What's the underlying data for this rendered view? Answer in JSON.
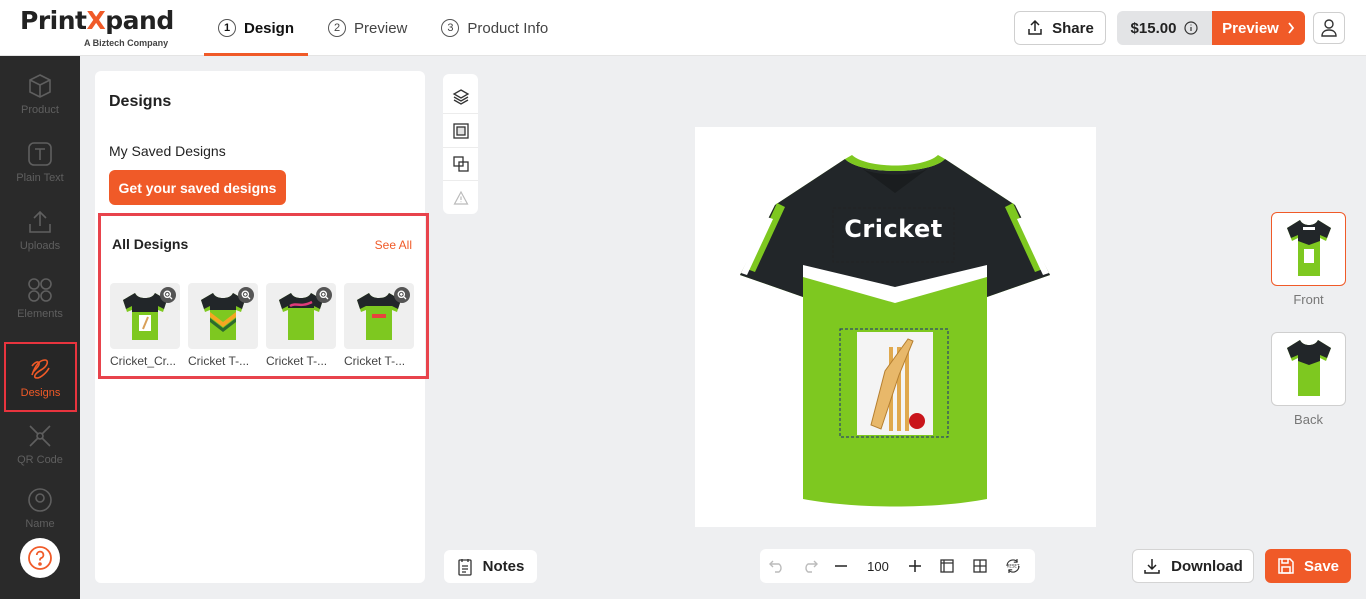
{
  "app": {
    "logo_main_prefix": "Print",
    "logo_main_x": "X",
    "logo_main_suffix": "pand",
    "logo_sub": "A Biztech Company"
  },
  "steps": [
    {
      "num": "1",
      "label": "Design",
      "active": true
    },
    {
      "num": "2",
      "label": "Preview",
      "active": false
    },
    {
      "num": "3",
      "label": "Product Info",
      "active": false
    }
  ],
  "header": {
    "share_label": "Share",
    "price": "$15.00",
    "preview_label": "Preview"
  },
  "rail": {
    "items": [
      {
        "label": "Product",
        "icon": "cube-icon"
      },
      {
        "label": "Plain Text",
        "icon": "text-icon"
      },
      {
        "label": "Uploads",
        "icon": "upload-icon"
      },
      {
        "label": "Elements",
        "icon": "elements-icon"
      },
      {
        "label": "Designs",
        "icon": "designs-icon",
        "active": true
      },
      {
        "label": "QR Code",
        "icon": "qr-code-icon"
      },
      {
        "label": "Name",
        "icon": "name-icon"
      }
    ]
  },
  "panel": {
    "title": "Designs",
    "saved_title": "My Saved Designs",
    "saved_button": "Get your saved designs",
    "all_title": "All Designs",
    "see_all": "See All",
    "designs": [
      {
        "label": "Cricket_Cr...",
        "variant": "cricket"
      },
      {
        "label": "Cricket T-...",
        "variant": "stripes"
      },
      {
        "label": "Cricket T-...",
        "variant": "swoosh"
      },
      {
        "label": "Cricket T-...",
        "variant": "maro"
      }
    ]
  },
  "canvas": {
    "text": "Cricket"
  },
  "views": [
    {
      "label": "Front",
      "active": true
    },
    {
      "label": "Back",
      "active": false
    }
  ],
  "bottom": {
    "notes_label": "Notes",
    "zoom_value": "100",
    "download_label": "Download",
    "save_label": "Save"
  },
  "colors": {
    "accent": "#f05a28",
    "highlight_border": "#e8434c",
    "shirt_green": "#7ec820",
    "shirt_dark": "#222629"
  }
}
